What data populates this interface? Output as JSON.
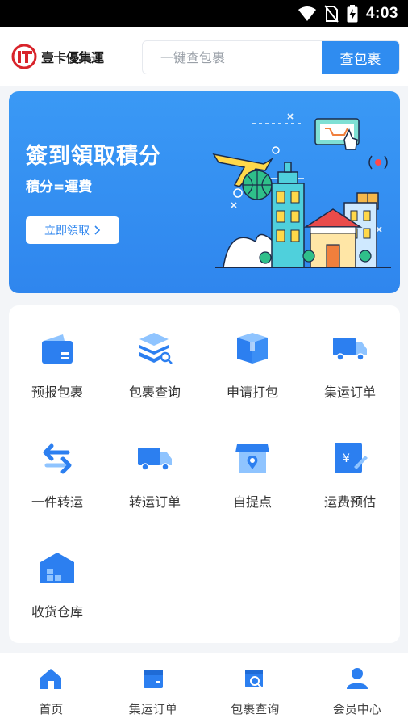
{
  "status_bar": {
    "time": "4:03",
    "icons": [
      "wifi-icon",
      "no-sim-icon",
      "battery-charging-icon"
    ]
  },
  "header": {
    "logo_text": "壹卡優集運",
    "search": {
      "placeholder": "一键查包裹",
      "value": "",
      "button_label": "查包裹"
    }
  },
  "banner": {
    "title": "簽到領取積分",
    "subtitle": "積分=運費",
    "button_label": "立即領取",
    "button_icon": "chevron-right-icon"
  },
  "features": [
    {
      "label": "预报包裹",
      "icon": "forecast-parcel-icon"
    },
    {
      "label": "包裹查询",
      "icon": "parcel-search-icon"
    },
    {
      "label": "申请打包",
      "icon": "package-box-icon"
    },
    {
      "label": "集运订单",
      "icon": "truck-icon"
    },
    {
      "label": "一件转运",
      "icon": "transfer-arrows-icon"
    },
    {
      "label": "转运订单",
      "icon": "truck-icon"
    },
    {
      "label": "自提点",
      "icon": "store-location-icon"
    },
    {
      "label": "运费预估",
      "icon": "fee-estimate-icon"
    },
    {
      "label": "收货仓库",
      "icon": "warehouse-icon"
    }
  ],
  "bottom_nav": [
    {
      "label": "首页",
      "icon": "home-icon"
    },
    {
      "label": "集运订单",
      "icon": "order-box-icon"
    },
    {
      "label": "包裹查询",
      "icon": "parcel-search-icon"
    },
    {
      "label": "会员中心",
      "icon": "user-icon"
    }
  ],
  "colors": {
    "accent": "#2f8cf0",
    "banner": "#3a99f5",
    "icon_blue": "#2c7ff0",
    "icon_light": "#8fc4ff",
    "background": "#f3f5f8"
  }
}
